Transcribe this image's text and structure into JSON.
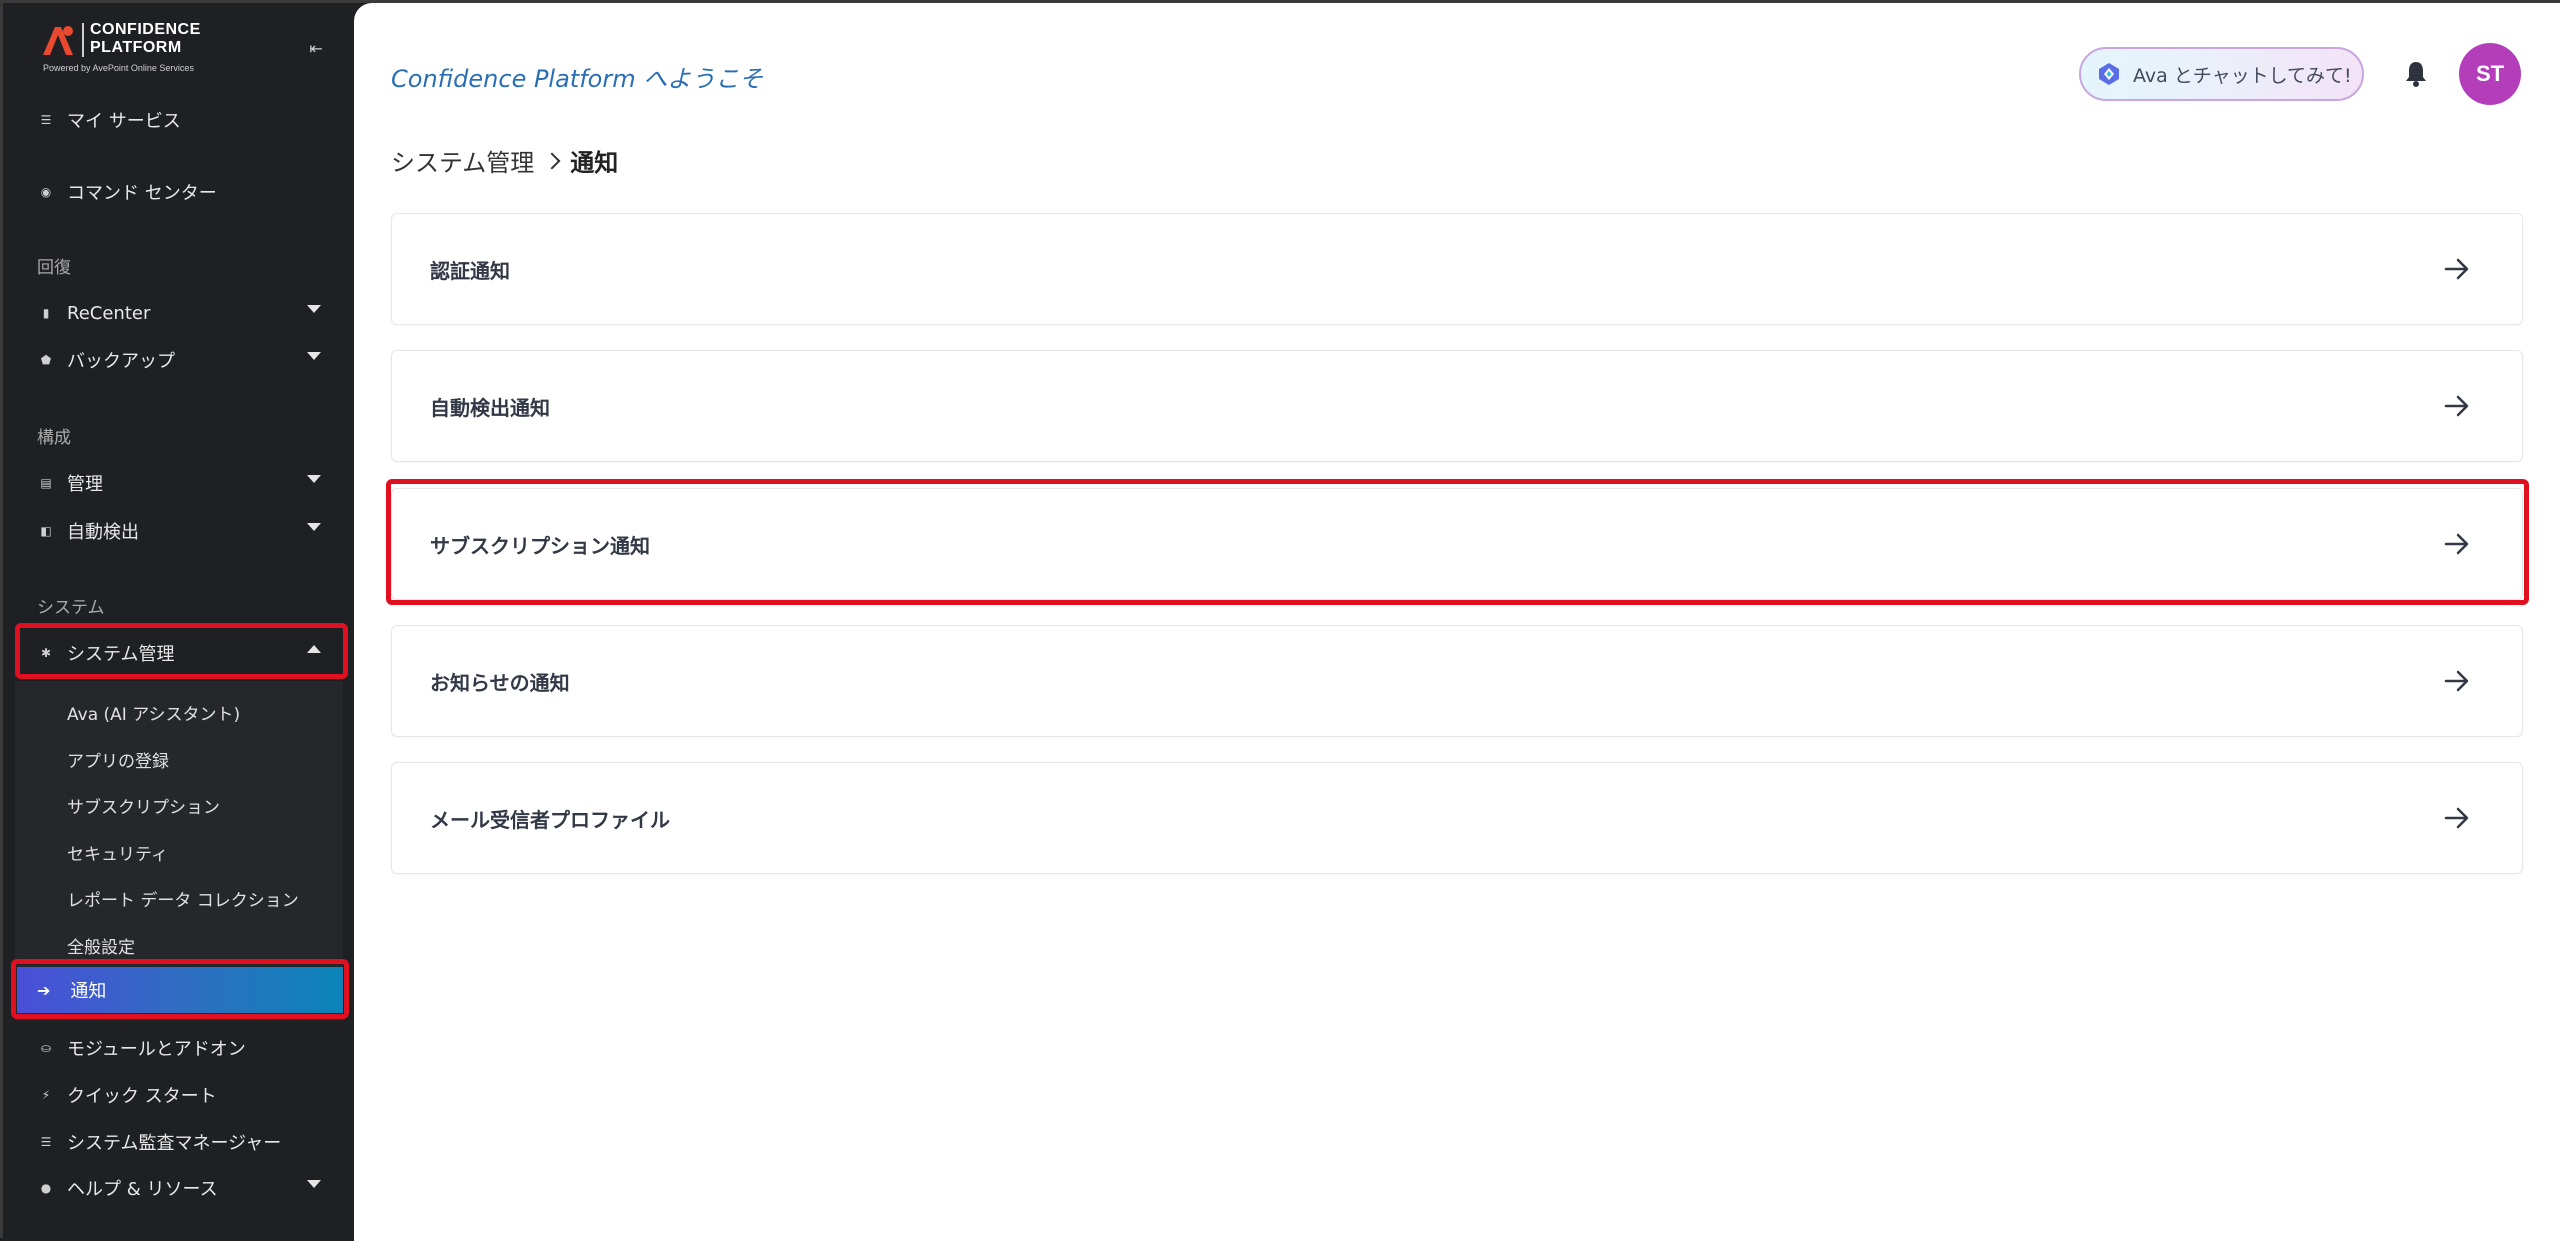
{
  "app": {
    "logo_title": "CONFIDENCE\nPLATFORM",
    "logo_subtitle": "Powered by AvePoint Online Services"
  },
  "sidebar": {
    "items": [
      {
        "label": "マイ サービス",
        "icon": "list-icon"
      },
      {
        "label": "コマンド センター",
        "icon": "globe-icon"
      }
    ],
    "section_recovery": "回復",
    "recovery_items": [
      {
        "label": "ReCenter",
        "icon": "document-icon"
      },
      {
        "label": "バックアップ",
        "icon": "shield-icon"
      }
    ],
    "section_config": "構成",
    "config_items": [
      {
        "label": "管理",
        "icon": "book-icon"
      },
      {
        "label": "自動検出",
        "icon": "cubes-icon"
      }
    ],
    "section_system": "システム",
    "system_admin": {
      "label": "システム管理",
      "icon": "gear-icon"
    },
    "system_sub_items": [
      "Ava (AI アシスタント)",
      "アプリの登録",
      "サブスクリプション",
      "セキュリティ",
      "レポート データ コレクション",
      "全般設定"
    ],
    "active_item": "通知",
    "bottom_items": [
      {
        "label": "モジュールとアドオン",
        "icon": "basket-icon"
      },
      {
        "label": "クイック スタート",
        "icon": "bolt-icon"
      },
      {
        "label": "システム監査マネージャー",
        "icon": "list-icon"
      },
      {
        "label": "ヘルプ & リソース",
        "icon": "help-icon"
      }
    ]
  },
  "header": {
    "welcome": "Confidence Platform へようこそ",
    "ava_button": "Ava とチャットしてみて!",
    "avatar_initials": "ST"
  },
  "breadcrumb": {
    "parent": "システム管理",
    "current": "通知"
  },
  "cards": [
    "認証通知",
    "自動検出通知",
    "サブスクリプション通知",
    "お知らせの通知",
    "メール受信者プロファイル"
  ],
  "colors": {
    "sidebar_bg": "#1f2024",
    "active_gradient_start": "#4a4fd8",
    "active_gradient_end": "#0a84b8",
    "highlight": "#e01020",
    "avatar": "#b43dba",
    "welcome_text": "#2a6fb5"
  }
}
